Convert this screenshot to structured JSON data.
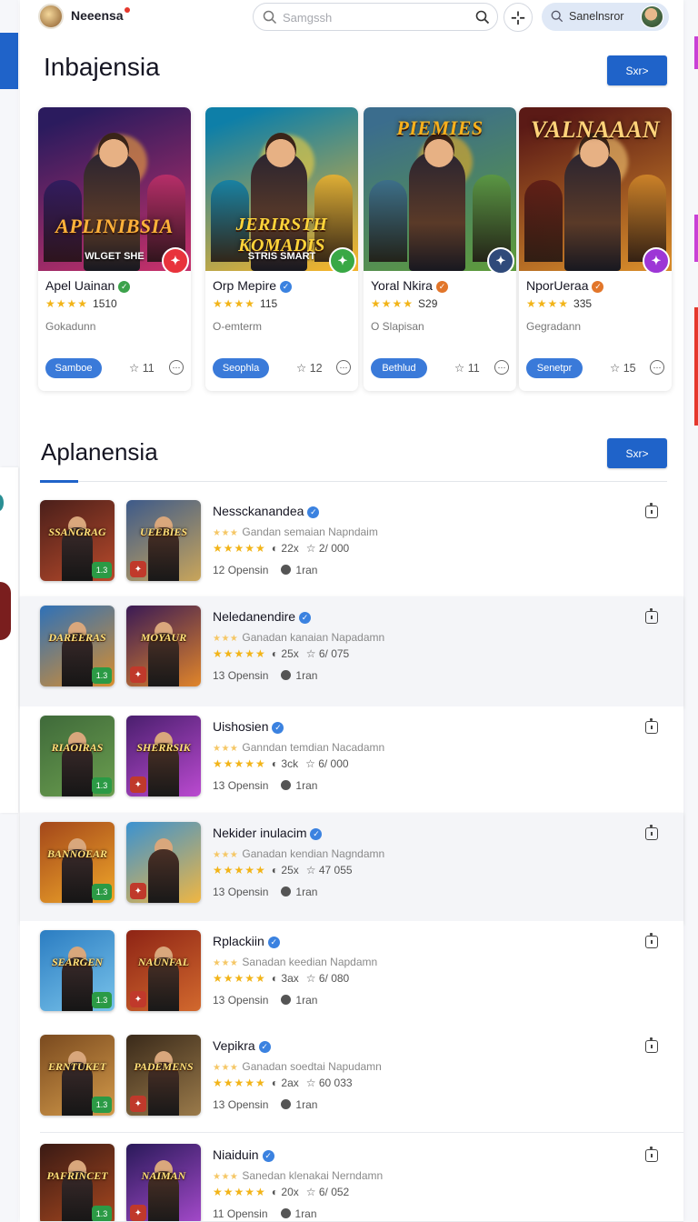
{
  "header": {
    "brand": "Neeensa",
    "search_placeholder": "Samgssh",
    "user_name": "Sanelnsror"
  },
  "featured": {
    "title": "Inbajensia",
    "button_label": "Sxr>",
    "cards": [
      {
        "art_title": "APLINIBSIA",
        "art_sub": "WLGEТ SHE",
        "title": "Apel Uainan",
        "rating": "1510",
        "meta": "Gokadunn",
        "pill": "Samboe",
        "count": "11",
        "colors": {
          "bg1": "#2b1b5e",
          "bg2": "#c2306a",
          "accent": "#ffb23a",
          "badge": "#e8333c"
        }
      },
      {
        "art_title": "JERIRSTH KOMADIS",
        "art_sub": "STRIS SMART",
        "title": "Orp Mepire",
        "rating": "115",
        "meta": "O-emterm",
        "pill": "Seophla",
        "count": "12",
        "colors": {
          "bg1": "#0e7fa8",
          "bg2": "#f0b32d",
          "accent": "#ffd43a",
          "badge": "#39a845"
        }
      },
      {
        "art_title": "PIEMIES",
        "art_sub": "",
        "title": "Yoral Nkira",
        "rating": "S29",
        "meta": "O Slapisan",
        "pill": "Bethlud",
        "count": "11",
        "colors": {
          "bg1": "#3b6d8d",
          "bg2": "#5d9a3e",
          "accent": "#f7b11d",
          "badge": "#2f4a7a"
        }
      },
      {
        "art_title": "VALNAAAN",
        "art_sub": "",
        "title": "NporUeraa",
        "rating": "335",
        "meta": "Gegradann",
        "pill": "Senetpr",
        "count": "15",
        "colors": {
          "bg1": "#5b1a16",
          "bg2": "#d58a2a",
          "accent": "#ffd37a",
          "badge": "#9d36d6"
        }
      }
    ]
  },
  "list": {
    "title": "Aplanensia",
    "button_label": "Sxr>",
    "rows": [
      {
        "title": "Nessckanandea",
        "sub": "Gandan semaian Napndaim",
        "views": "22x",
        "likes": "2/ 000",
        "count": "12",
        "meta1": "Opensin",
        "meta2": "1ran",
        "t1": {
          "label": "SSANGRAG",
          "c1": "#4a1f1a",
          "c2": "#b84a2b"
        },
        "t2": {
          "label": "UEEBIES",
          "c1": "#3d5a8a",
          "c2": "#c9a55a"
        }
      },
      {
        "title": "Neledanendire",
        "sub": "Ganadan kanaian Napadamn",
        "views": "25x",
        "likes": "6/ 075",
        "count": "13",
        "meta1": "Opensin",
        "meta2": "1ran",
        "t1": {
          "label": "DAREERAS",
          "c1": "#2e71b8",
          "c2": "#d98e2d"
        },
        "t2": {
          "label": "MOYAUR",
          "c1": "#3a1a55",
          "c2": "#e0852a"
        }
      },
      {
        "title": "Uishosien",
        "sub": "Ganndan temdian Nacadamn",
        "views": "3ck",
        "likes": "6/ 000",
        "count": "13",
        "meta1": "Opensin",
        "meta2": "1ran",
        "t1": {
          "label": "RIAOIRAS",
          "c1": "#3f6a3a",
          "c2": "#6b9e4f"
        },
        "t2": {
          "label": "SHERRSIK",
          "c1": "#4a1f6e",
          "c2": "#ba4ad0"
        }
      },
      {
        "title": "Nekider inulacim",
        "sub": "Ganadan kendian Nagndamn",
        "views": "25x",
        "likes": "47 055",
        "count": "13",
        "meta1": "Opensin",
        "meta2": "1ran",
        "t1": {
          "label": "BANNOEAR",
          "c1": "#a3471a",
          "c2": "#f0a72a"
        },
        "t2": {
          "label": "",
          "c1": "#3a92d1",
          "c2": "#f0b642"
        }
      },
      {
        "title": "Rplackiin",
        "sub": "Sanadan keedian Napdamn",
        "views": "3ax",
        "likes": "6/ 080",
        "count": "13",
        "meta1": "Opensin",
        "meta2": "1ran",
        "t1": {
          "label": "SEARGEN",
          "c1": "#2b7dc2",
          "c2": "#79c3ea"
        },
        "t2": {
          "label": "NAUNFAL",
          "c1": "#8e2415",
          "c2": "#d2692e"
        }
      },
      {
        "title": "Vepikra",
        "sub": "Ganadan soedtai Napudamn",
        "views": "2ax",
        "likes": "60 033",
        "count": "13",
        "meta1": "Opensin",
        "meta2": "1ran",
        "t1": {
          "label": "ERNTUKET",
          "c1": "#7a4a1f",
          "c2": "#d39a4a"
        },
        "t2": {
          "label": "PADEMENS",
          "c1": "#3a2a1a",
          "c2": "#9a7a4a"
        }
      },
      {
        "title": "Niaiduin",
        "sub": "Sanedan klenakai Nerndamn",
        "views": "20x",
        "likes": "6/ 052",
        "count": "11",
        "meta1": "Opensin",
        "meta2": "1ran",
        "t1": {
          "label": "PAFRINCET",
          "c1": "#3a1a14",
          "c2": "#a8481f"
        },
        "t2": {
          "label": "NAIMAN",
          "c1": "#2a1a5a",
          "c2": "#a54acb"
        }
      }
    ]
  },
  "colors": {
    "primary": "#1f63c9",
    "star": "#f2b418"
  }
}
